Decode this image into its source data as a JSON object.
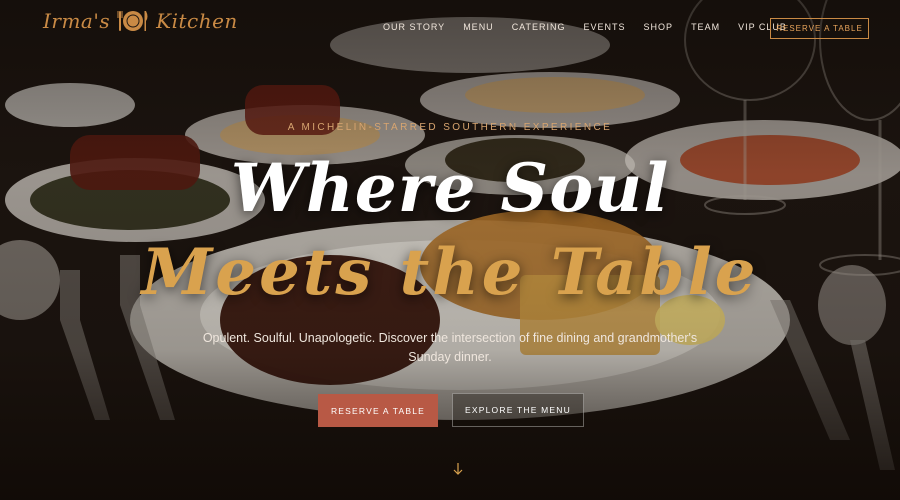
{
  "brand": {
    "name_left": "Irma's",
    "name_right": "Kitchen",
    "icon": "plate-fork-knife-icon",
    "color": "#c98a45"
  },
  "nav": {
    "links": [
      "OUR STORY",
      "MENU",
      "CATERING",
      "EVENTS",
      "SHOP",
      "TEAM",
      "VIP CLUB"
    ],
    "cta": "RESERVE A TABLE"
  },
  "hero": {
    "eyebrow": "A MICHELIN-STARRED SOUTHERN EXPERIENCE",
    "headline_1": "Where Soul",
    "headline_2": "Meets the Table",
    "subcopy": "Opulent. Soulful. Unapologetic. Discover the intersection of fine dining and grandmother's Sunday dinner.",
    "primary_button": "RESERVE A TABLE",
    "secondary_button": "EXPLORE THE MENU",
    "scroll_icon": "chevron-down-icon"
  },
  "colors": {
    "accent": "#d9a24e",
    "button": "#b85945",
    "background": "#140d08"
  }
}
